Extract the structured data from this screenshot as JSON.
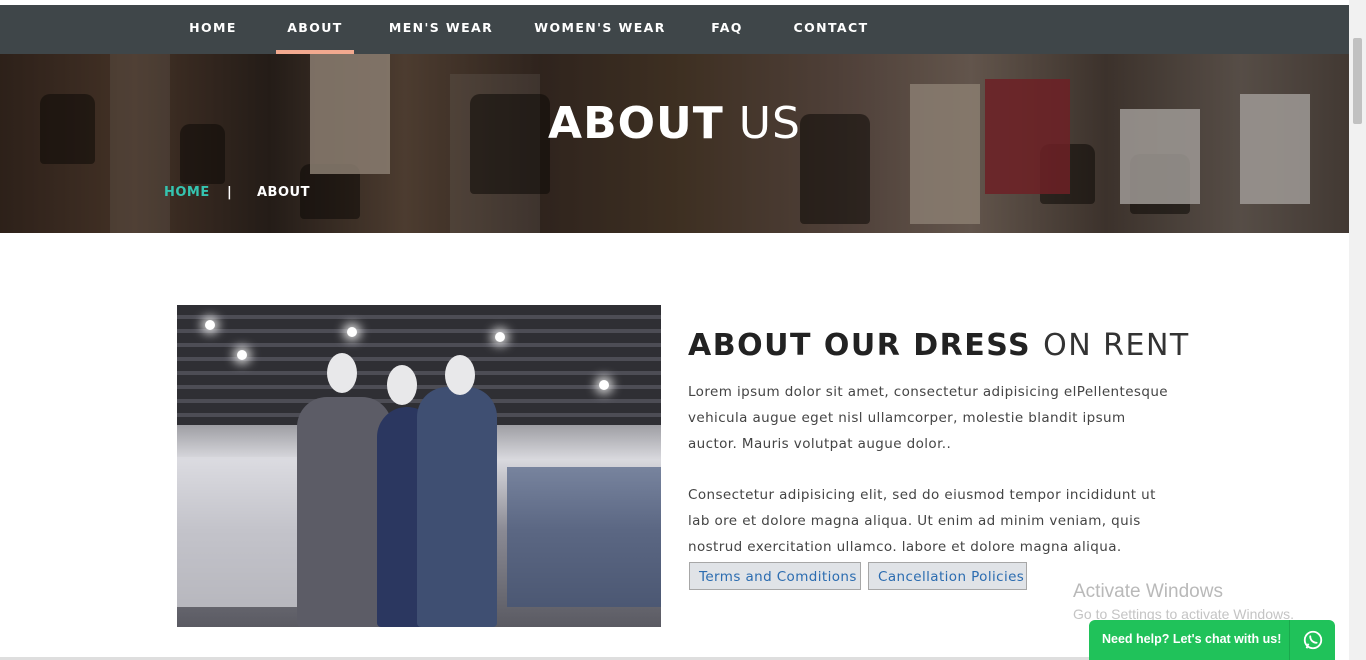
{
  "nav": {
    "items": [
      {
        "label": "HOME",
        "active": false
      },
      {
        "label": "ABOUT",
        "active": true
      },
      {
        "label": "MEN'S WEAR",
        "active": false
      },
      {
        "label": "WOMEN'S WEAR",
        "active": false
      },
      {
        "label": "FAQ",
        "active": false
      },
      {
        "label": "CONTACT",
        "active": false
      }
    ],
    "background": "#3f4649",
    "active_underline_color": "#f2a98f"
  },
  "hero": {
    "title_bold": "ABOUT",
    "title_light": "US",
    "breadcrumb": {
      "home": "HOME",
      "separator": "|",
      "current": "ABOUT"
    },
    "breadcrumb_home_color": "#35c4b0"
  },
  "about": {
    "heading_bold": "ABOUT OUR DRESS",
    "heading_light": "ON RENT",
    "paragraph1": "Lorem ipsum dolor sit amet, consectetur adipisicing elPellentesque vehicula augue eget nisl ullamcorper, molestie blandit ipsum auctor. Mauris volutpat augue dolor..",
    "paragraph2": "Consectetur adipisicing elit, sed do eiusmod tempor incididunt ut lab ore et dolore magna aliqua. Ut enim ad minim veniam, quis nostrud exercitation ullamco. labore et dolore magna aliqua.",
    "buttons": {
      "terms": "Terms and Comditions",
      "cancellation": "Cancellation Policies"
    }
  },
  "watermark": {
    "title": "Activate Windows",
    "subtitle": "Go to Settings to activate Windows."
  },
  "chat": {
    "label": "Need help? Let's chat with us!",
    "icon": "whatsapp-icon",
    "color": "#20c25a"
  }
}
